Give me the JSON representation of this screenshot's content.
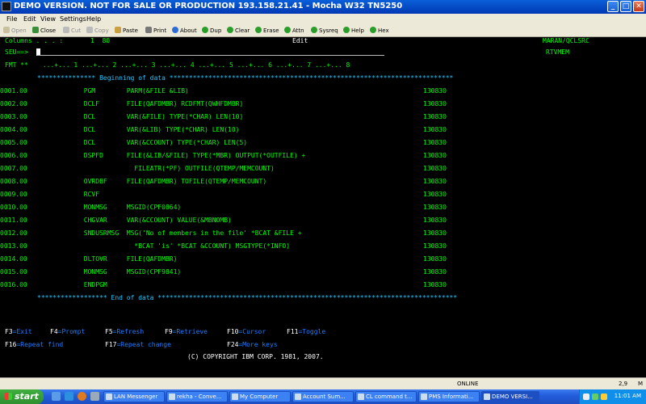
{
  "window": {
    "title": "DEMO VERSION. NOT FOR SALE OR PRODUCTION 193.158.21.41 - Mocha W32 TN5250",
    "buttons": [
      "_",
      "□",
      "✕"
    ]
  },
  "menu": {
    "items": [
      "File",
      "Edit",
      "View",
      "Settings",
      "Help"
    ]
  },
  "toolbar": {
    "items": [
      {
        "label": "Open",
        "enabled": false
      },
      {
        "label": "Close",
        "enabled": true
      },
      {
        "label": "Cut",
        "enabled": false
      },
      {
        "label": "Copy",
        "enabled": false
      },
      {
        "label": "Paste",
        "enabled": true
      },
      {
        "label": "Print",
        "enabled": true
      },
      {
        "label": "About",
        "enabled": true
      },
      {
        "label": "Dup",
        "enabled": true
      },
      {
        "label": "Clear",
        "enabled": true
      },
      {
        "label": "Erase",
        "enabled": true
      },
      {
        "label": "Attn",
        "enabled": true
      },
      {
        "label": "Sysreq",
        "enabled": true
      },
      {
        "label": "Help",
        "enabled": true
      },
      {
        "label": "Hex",
        "enabled": true
      }
    ]
  },
  "screen": {
    "columns_label": "Columns . . . :",
    "columns_value": "1  80",
    "mode": "Edit",
    "source_file": "MARAN/QCLSRC",
    "member": "RTVMEM",
    "seu_prompt": "SEU==>",
    "fmt_label": "FMT **",
    "ruler": " ...+... 1 ...+... 2 ...+... 3 ...+... 4 ...+... 5 ...+... 6 ...+... 7 ...+... 8",
    "beginning_marker": "*************** Beginning of data *************************************************************************",
    "end_marker": "****************** End of data *****************************************************************************",
    "lines": [
      {
        "seq": "0001.00",
        "code": "            PGM        PARM(&FILE &LIB)",
        "date": "130830"
      },
      {
        "seq": "0002.00",
        "code": "            DCLF       FILE(QAFDMBR) RCDFMT(QWHFDMBR)",
        "date": "130830"
      },
      {
        "seq": "0003.00",
        "code": "            DCL        VAR(&FILE) TYPE(*CHAR) LEN(10)",
        "date": "130830"
      },
      {
        "seq": "0004.00",
        "code": "            DCL        VAR(&LIB) TYPE(*CHAR) LEN(10)",
        "date": "130830"
      },
      {
        "seq": "0005.00",
        "code": "            DCL        VAR(&CCOUNT) TYPE(*CHAR) LEN(5)",
        "date": "130830"
      },
      {
        "seq": "0006.00",
        "code": "            DSPFD      FILE(&LIB/&FILE) TYPE(*MBR) OUTPUT(*OUTFILE) +",
        "date": "130830"
      },
      {
        "seq": "0007.00",
        "code": "                         FILEATR(*PF) OUTFILE(QTEMP/MEMCOUNT)",
        "date": "130830"
      },
      {
        "seq": "0008.00",
        "code": "            OVRDBF     FILE(QAFDMBR) TOFILE(QTEMP/MEMCOUNT)",
        "date": "130830"
      },
      {
        "seq": "0009.00",
        "code": "            RCVF",
        "date": "130830"
      },
      {
        "seq": "0010.00",
        "code": "            MONMSG     MSGID(CPF0864)",
        "date": "130830"
      },
      {
        "seq": "0011.00",
        "code": "            CHGVAR     VAR(&CCOUNT) VALUE(&MBNOMB)",
        "date": "130830"
      },
      {
        "seq": "0012.00",
        "code": "            SNDUSRMSG  MSG('No of members in the file' *BCAT &FILE +",
        "date": "130830"
      },
      {
        "seq": "0013.00",
        "code": "                         *BCAT 'is' *BCAT &CCOUNT) MSGTYPE(*INFO)",
        "date": "130830"
      },
      {
        "seq": "0014.00",
        "code": "            DLTOVR     FILE(QAFDMBR)",
        "date": "130830"
      },
      {
        "seq": "0015.00",
        "code": "            MONMSG     MSGID(CPF9841)",
        "date": "130830"
      },
      {
        "seq": "0016.00",
        "code": "            ENDPGM",
        "date": "130830"
      }
    ],
    "fkeys_row1": [
      {
        "key": "F3",
        "label": "=Exit"
      },
      {
        "key": "F4",
        "label": "=Prompt"
      },
      {
        "key": "F5",
        "label": "=Refresh"
      },
      {
        "key": "F9",
        "label": "=Retrieve"
      },
      {
        "key": "F10",
        "label": "=Cursor"
      },
      {
        "key": "F11",
        "label": "=Toggle"
      }
    ],
    "fkeys_row2": [
      {
        "key": "F16",
        "label": "=Repeat find"
      },
      {
        "key": "F17",
        "label": "=Repeat change"
      },
      {
        "key": "F24",
        "label": "=More keys"
      }
    ],
    "copyright": "(C) COPYRIGHT IBM CORP. 1981, 2007."
  },
  "status": {
    "state": "ONLINE",
    "cursor_pos": "2,9",
    "indicator": "M"
  },
  "taskbar": {
    "start_label": "start",
    "tasks": [
      "LAN Messenger",
      "rekha - Conve...",
      "My Computer",
      "Account Sum...",
      "CL command t...",
      "PMS Informati...",
      "DEMO VERSI..."
    ],
    "clock": "11:01 AM"
  },
  "colors": {
    "green": "#00ff00",
    "cyan": "#25c5ff",
    "blue": "#1e7cff",
    "white": "#ffffff"
  }
}
